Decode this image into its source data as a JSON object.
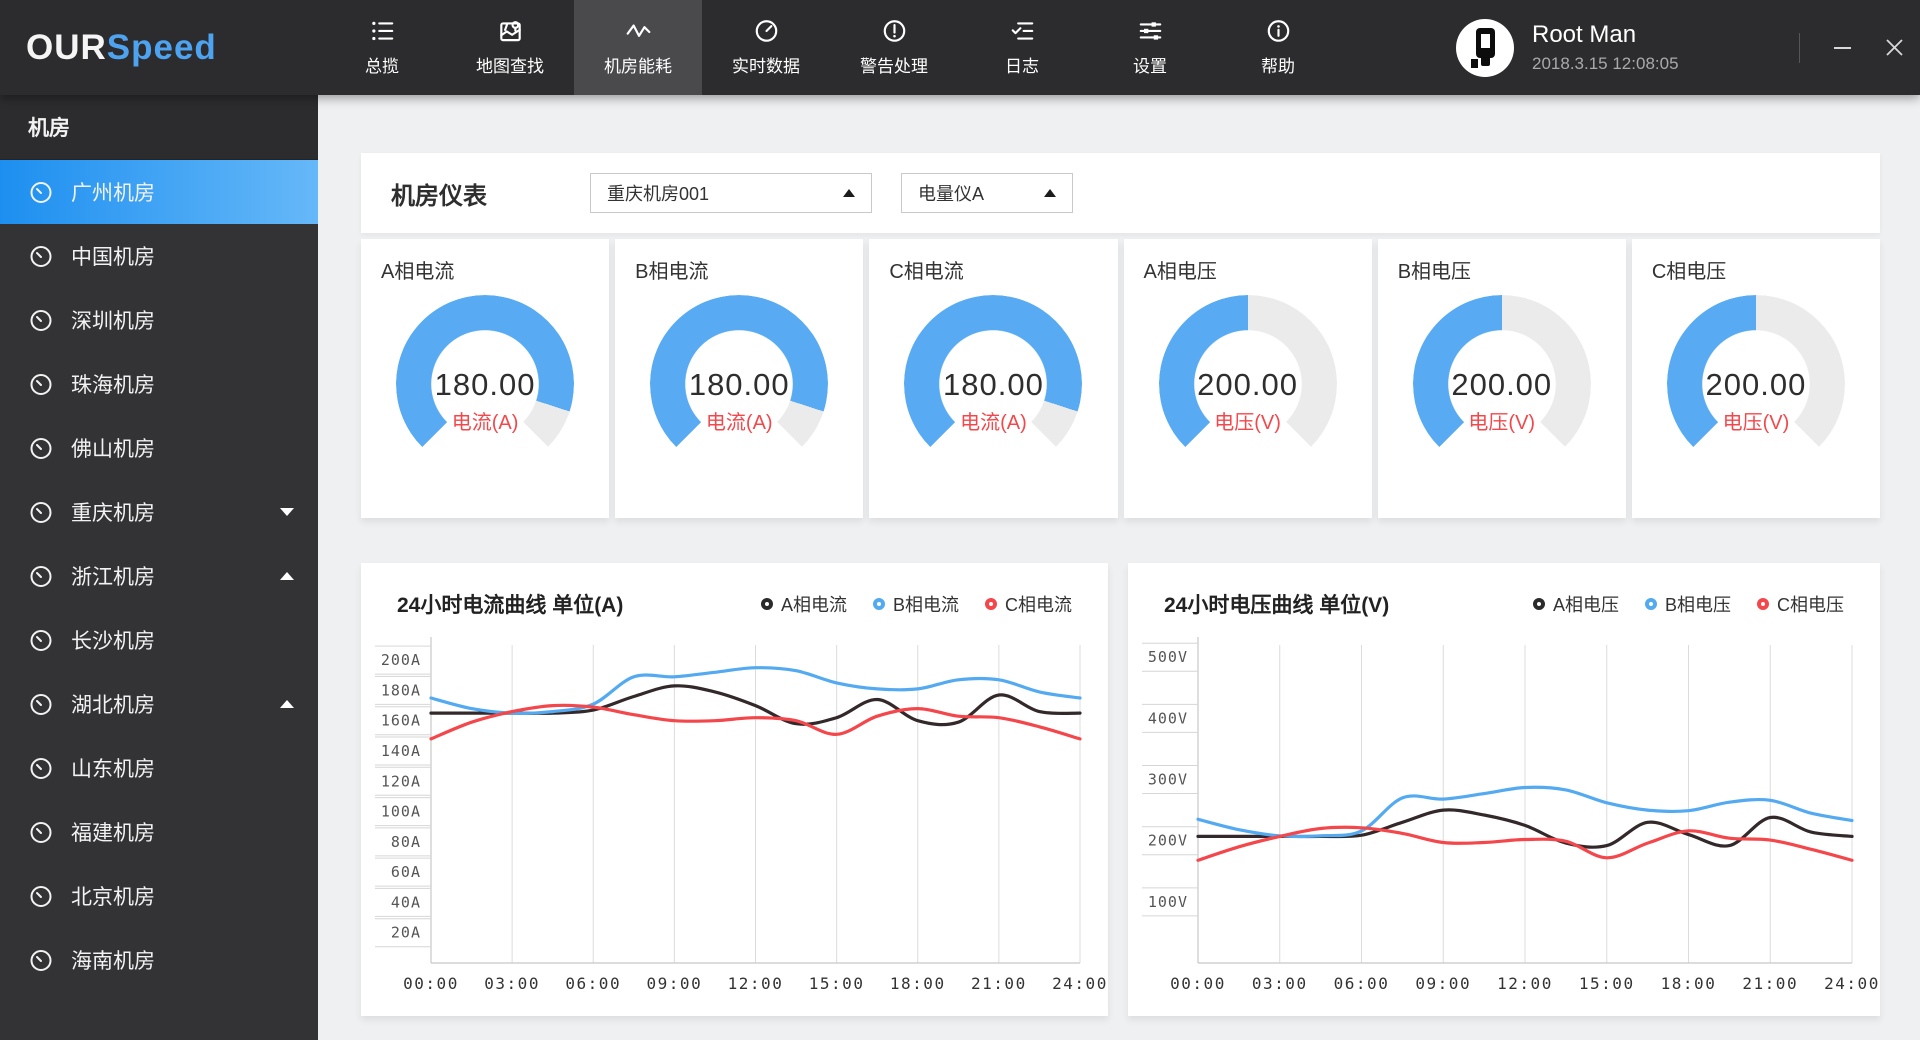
{
  "app": {
    "brand_our": "OUR",
    "brand_speed": "Speed",
    "user_name": "Root Man",
    "datetime": "2018.3.15 12:08:05"
  },
  "colors": {
    "accent_blue": "#58abf3",
    "gauge_track": "#ebebeb",
    "unit_red": "#f4474b",
    "line_black": "#33282a",
    "line_blue": "#54aaf0",
    "line_red": "#f4474b",
    "sidebar_selected_from": "#1d8ff0",
    "sidebar_selected_to": "#66b8f8"
  },
  "nav": {
    "items": [
      {
        "label": "总揽",
        "icon": "overview-list-icon",
        "active": false
      },
      {
        "label": "地图查找",
        "icon": "map-search-icon",
        "active": false
      },
      {
        "label": "机房能耗",
        "icon": "energy-wave-icon",
        "active": true
      },
      {
        "label": "实时数据",
        "icon": "realtime-gauge-icon",
        "active": false
      },
      {
        "label": "警告处理",
        "icon": "alert-circle-icon",
        "active": false
      },
      {
        "label": "日志",
        "icon": "log-list-icon",
        "active": false
      },
      {
        "label": "设置",
        "icon": "settings-sliders-icon",
        "active": false
      },
      {
        "label": "帮助",
        "icon": "help-info-icon",
        "active": false
      }
    ]
  },
  "sidebar": {
    "title": "机房",
    "items": [
      {
        "label": "广州机房",
        "selected": true,
        "arrow": null
      },
      {
        "label": "中国机房",
        "selected": false,
        "arrow": null
      },
      {
        "label": "深圳机房",
        "selected": false,
        "arrow": null
      },
      {
        "label": "珠海机房",
        "selected": false,
        "arrow": null
      },
      {
        "label": "佛山机房",
        "selected": false,
        "arrow": null
      },
      {
        "label": "重庆机房",
        "selected": false,
        "arrow": "down"
      },
      {
        "label": "浙江机房",
        "selected": false,
        "arrow": "up"
      },
      {
        "label": "长沙机房",
        "selected": false,
        "arrow": null
      },
      {
        "label": "湖北机房",
        "selected": false,
        "arrow": "up"
      },
      {
        "label": "山东机房",
        "selected": false,
        "arrow": null
      },
      {
        "label": "福建机房",
        "selected": false,
        "arrow": null
      },
      {
        "label": "北京机房",
        "selected": false,
        "arrow": null
      },
      {
        "label": "海南机房",
        "selected": false,
        "arrow": null
      }
    ]
  },
  "panel": {
    "title": "机房仪表",
    "room_select_value": "重庆机房001",
    "meter_select_value": "电量仪A"
  },
  "gauges": [
    {
      "title": "A相电流",
      "value": "180.00",
      "unit_label": "电流(A)",
      "percent": 0.9
    },
    {
      "title": "B相电流",
      "value": "180.00",
      "unit_label": "电流(A)",
      "percent": 0.9
    },
    {
      "title": "C相电流",
      "value": "180.00",
      "unit_label": "电流(A)",
      "percent": 0.9
    },
    {
      "title": "A相电压",
      "value": "200.00",
      "unit_label": "电压(V)",
      "percent": 0.5
    },
    {
      "title": "B相电压",
      "value": "200.00",
      "unit_label": "电压(V)",
      "percent": 0.5
    },
    {
      "title": "C相电压",
      "value": "200.00",
      "unit_label": "电压(V)",
      "percent": 0.5
    }
  ],
  "chart_data": [
    {
      "type": "line",
      "title": "24小时电流曲线 单位(A)",
      "ylabel_unit": "A",
      "y_max": 210,
      "y_ticks": [
        {
          "value": 200,
          "label": "200A"
        },
        {
          "value": 180,
          "label": "180A"
        },
        {
          "value": 160,
          "label": "160A"
        },
        {
          "value": 140,
          "label": "140A"
        },
        {
          "value": 120,
          "label": "120A"
        },
        {
          "value": 100,
          "label": "100A"
        },
        {
          "value": 80,
          "label": "80A"
        },
        {
          "value": 60,
          "label": "60A"
        },
        {
          "value": 40,
          "label": "40A"
        },
        {
          "value": 20,
          "label": "20A"
        }
      ],
      "x_labels": [
        "00:00",
        "03:00",
        "06:00",
        "09:00",
        "12:00",
        "15:00",
        "18:00",
        "21:00",
        "24:00"
      ],
      "x_interval_hours": 1.5,
      "legend": [
        {
          "name": "A相电流",
          "color": "#2b2b2b"
        },
        {
          "name": "B相电流",
          "color": "#54aaf0"
        },
        {
          "name": "C相电流",
          "color": "#f4474b"
        }
      ],
      "series": [
        {
          "name": "A相电流",
          "color": "#33282a",
          "values": [
            165,
            165,
            165,
            165,
            167,
            176,
            183,
            179,
            170,
            158,
            162,
            174,
            160,
            159,
            177,
            166,
            165
          ]
        },
        {
          "name": "B相电流",
          "color": "#54aaf0",
          "values": [
            175,
            168,
            165,
            166,
            171,
            189,
            189,
            192,
            195,
            193,
            185,
            181,
            181,
            187,
            187,
            179,
            175
          ]
        },
        {
          "name": "C相电流",
          "color": "#f4474b",
          "values": [
            148,
            159,
            166,
            170,
            169,
            164,
            160,
            160,
            162,
            160,
            151,
            163,
            168,
            163,
            162,
            156,
            148
          ]
        }
      ]
    },
    {
      "type": "line",
      "title": "24小时电压曲线 单位(V)",
      "ylabel_unit": "V",
      "y_max": 520,
      "y_ticks": [
        {
          "value": 500,
          "label": "500V"
        },
        {
          "value": 400,
          "label": "400V"
        },
        {
          "value": 300,
          "label": "300V"
        },
        {
          "value": 200,
          "label": "200V"
        },
        {
          "value": 100,
          "label": "100V"
        }
      ],
      "x_labels": [
        "00:00",
        "03:00",
        "06:00",
        "09:00",
        "12:00",
        "15:00",
        "18:00",
        "21:00",
        "24:00"
      ],
      "x_interval_hours": 1.5,
      "legend": [
        {
          "name": "A相电压",
          "color": "#2b2b2b"
        },
        {
          "name": "B相电压",
          "color": "#54aaf0"
        },
        {
          "name": "C相电压",
          "color": "#f4474b"
        }
      ],
      "series": [
        {
          "name": "A相电压",
          "color": "#33282a",
          "values": [
            207,
            207,
            207,
            207,
            209,
            230,
            250,
            242,
            225,
            196,
            192,
            230,
            210,
            192,
            238,
            214,
            207
          ]
        },
        {
          "name": "B相电压",
          "color": "#54aaf0",
          "values": [
            235,
            218,
            208,
            208,
            216,
            270,
            268,
            277,
            287,
            283,
            262,
            250,
            249,
            263,
            266,
            245,
            233
          ]
        },
        {
          "name": "C相电压",
          "color": "#f4474b",
          "values": [
            168,
            190,
            207,
            220,
            221,
            212,
            197,
            197,
            202,
            199,
            172,
            196,
            216,
            204,
            201,
            186,
            168
          ]
        }
      ]
    }
  ]
}
